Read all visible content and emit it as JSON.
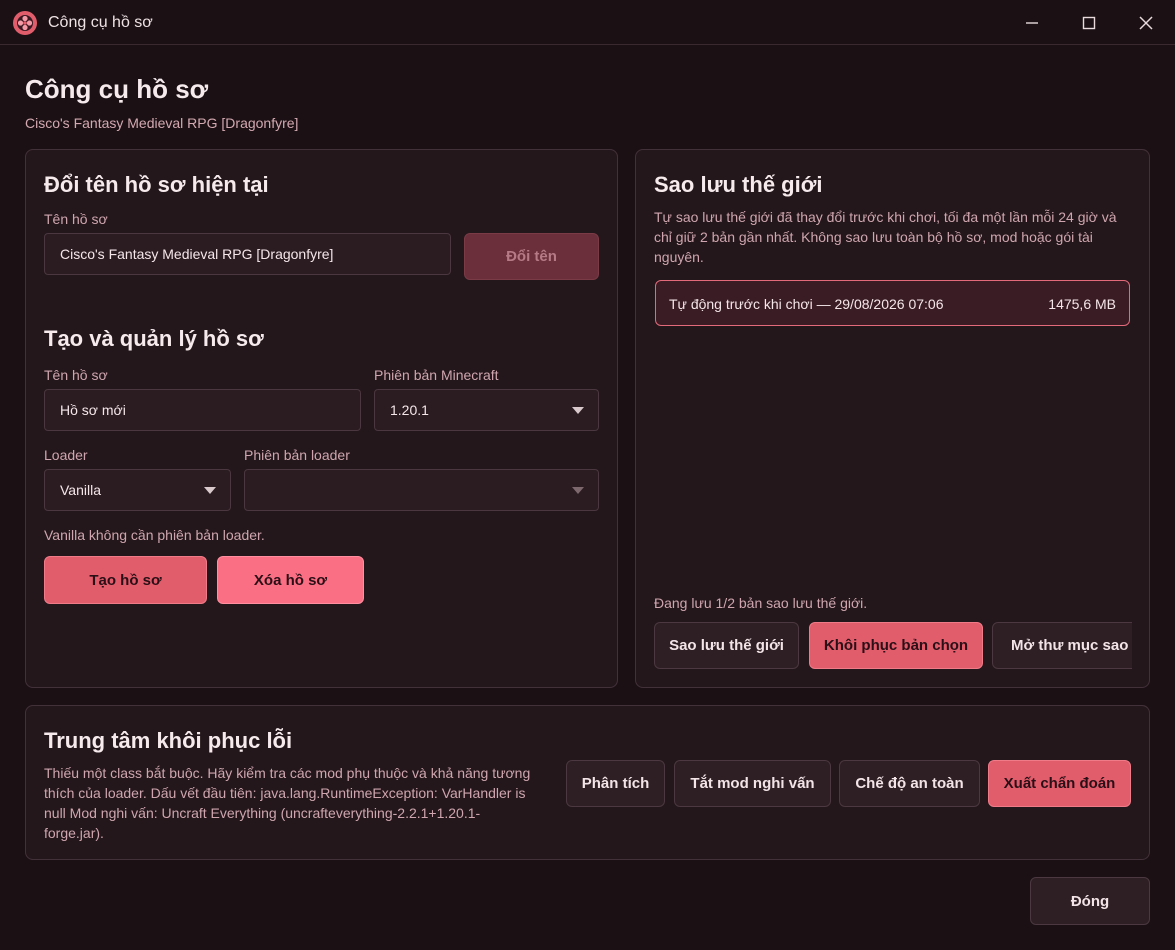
{
  "window": {
    "title": "Công cụ hồ sơ",
    "app_icon": "app-logo-icon"
  },
  "header": {
    "title": "Công cụ hồ sơ",
    "subtitle": "Cisco's Fantasy Medieval RPG [Dragonfyre]"
  },
  "rename": {
    "title": "Đổi tên hồ sơ hiện tại",
    "name_label": "Tên hồ sơ",
    "name_value": "Cisco's Fantasy Medieval RPG [Dragonfyre]",
    "button": "Đổi tên"
  },
  "create": {
    "title": "Tạo và quản lý hồ sơ",
    "name_label": "Tên hồ sơ",
    "name_value": "Hồ sơ mới",
    "mc_label": "Phiên bản Minecraft",
    "mc_value": "1.20.1",
    "loader_label": "Loader",
    "loader_value": "Vanilla",
    "loader_version_label": "Phiên bản loader",
    "loader_version_value": "",
    "note": "Vanilla không cần phiên bản loader.",
    "create_button": "Tạo hồ sơ",
    "delete_button": "Xóa hồ sơ"
  },
  "backup": {
    "title": "Sao lưu thế giới",
    "desc": "Tự sao lưu thế giới đã thay đổi trước khi chơi, tối đa một lần mỗi 24 giờ và chỉ giữ 2 bản gần nhất. Không sao lưu toàn bộ hồ sơ, mod hoặc gói tài nguyên.",
    "items": [
      {
        "name": "Tự động trước khi chơi — 29/08/2026 07:06",
        "size": "1475,6 MB"
      }
    ],
    "status": "Đang lưu 1/2 bản sao lưu thế giới.",
    "backup_button": "Sao lưu thế giới",
    "restore_button": "Khôi phục bản chọn",
    "open_folder_button": "Mở thư mục sao lưu"
  },
  "recovery": {
    "title": "Trung tâm khôi phục lỗi",
    "desc": "Thiếu một class bắt buộc. Hãy kiểm tra các mod phụ thuộc và khả năng tương thích của loader. Dấu vết đầu tiên: java.lang.RuntimeException: VarHandler is null Mod nghi vấn: Uncraft Everything (uncrafteverything-2.2.1+1.20.1-forge.jar).",
    "analyze_button": "Phân tích",
    "disable_button": "Tắt mod nghi vấn",
    "safe_button": "Chế độ an toàn",
    "export_button": "Xuất chẩn đoán"
  },
  "footer": {
    "close_button": "Đóng"
  }
}
